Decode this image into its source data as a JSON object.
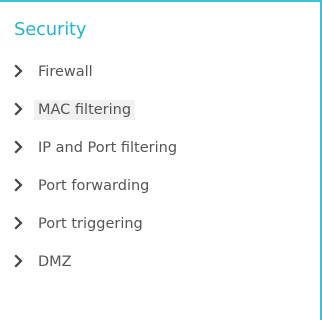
{
  "accent_color": "#3bc3d3",
  "title_color": "#2ab2c6",
  "section": {
    "title": "Security",
    "items": [
      {
        "label": "Firewall",
        "icon": "chevron-right-icon"
      },
      {
        "label": "MAC filtering",
        "icon": "chevron-right-icon"
      },
      {
        "label": "IP and Port filtering",
        "icon": "chevron-right-icon"
      },
      {
        "label": "Port forwarding",
        "icon": "chevron-right-icon"
      },
      {
        "label": "Port triggering",
        "icon": "chevron-right-icon"
      },
      {
        "label": "DMZ",
        "icon": "chevron-right-icon"
      }
    ]
  }
}
